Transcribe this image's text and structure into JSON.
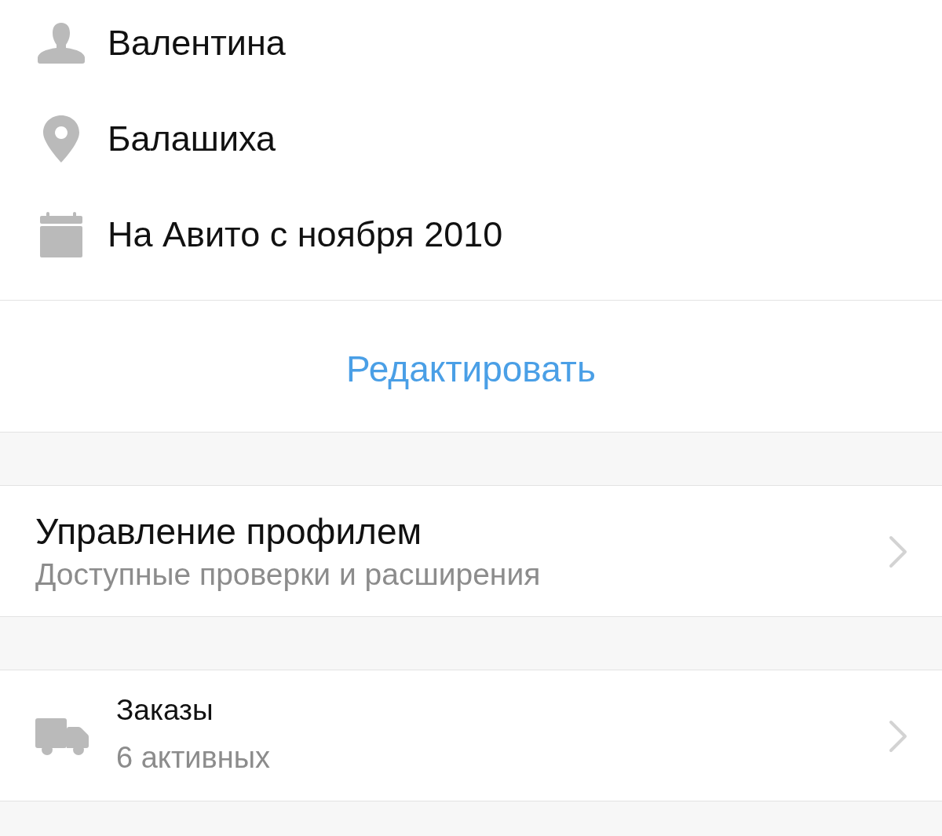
{
  "profile_details": [
    {
      "kind": "person",
      "text": "Валентина"
    },
    {
      "kind": "location",
      "text": "Балашиха"
    },
    {
      "kind": "calendar",
      "text": "На Авито с ноября 2010"
    }
  ],
  "edit_link": "Редактировать",
  "menu_items": [
    {
      "kind": "plain",
      "title": "Управление профилем",
      "subtitle": "Доступные проверки и расширения"
    },
    {
      "kind": "truck",
      "title": "Заказы",
      "subtitle": "6 активных"
    }
  ]
}
